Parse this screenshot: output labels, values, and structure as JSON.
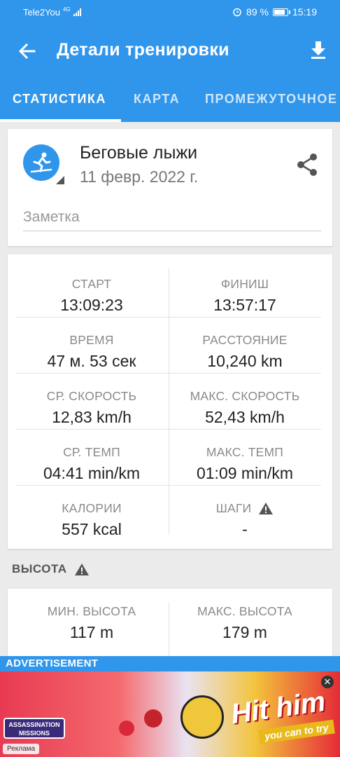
{
  "status_bar": {
    "carrier": "Tele2You",
    "network": "4G",
    "battery": "89 %",
    "battery_level": 0.89,
    "time": "15:19"
  },
  "toolbar": {
    "title": "Детали тренировки"
  },
  "tabs": [
    {
      "label": "СТАТИСТИКА",
      "active": true
    },
    {
      "label": "КАРТА",
      "active": false
    },
    {
      "label": "ПРОМЕЖУТОЧНОЕ",
      "active": false
    }
  ],
  "activity": {
    "name": "Беговые лыжи",
    "date": "11 февр. 2022 г.",
    "note_placeholder": "Заметка"
  },
  "stats": [
    {
      "left": {
        "label": "СТАРТ",
        "value": "13:09:23"
      },
      "right": {
        "label": "ФИНИШ",
        "value": "13:57:17"
      }
    },
    {
      "left": {
        "label": "ВРЕМЯ",
        "value": "47 м. 53 сек"
      },
      "right": {
        "label": "РАССТОЯНИЕ",
        "value": "10,240 km"
      }
    },
    {
      "left": {
        "label": "СР. СКОРОСТЬ",
        "value": "12,83 km/h"
      },
      "right": {
        "label": "МАКС. СКОРОСТЬ",
        "value": "52,43 km/h"
      }
    },
    {
      "left": {
        "label": "СР. ТЕМП",
        "value": "04:41 min/km"
      },
      "right": {
        "label": "МАКС. ТЕМП",
        "value": "01:09 min/km"
      }
    },
    {
      "left": {
        "label": "КАЛОРИИ",
        "value": "557 kcal"
      },
      "right": {
        "label": "ШАГИ",
        "value": "-",
        "warning": true
      }
    }
  ],
  "altitude": {
    "section_title": "ВЫСОТА",
    "min": {
      "label": "МИН. ВЫСОТА",
      "value": "117 m"
    },
    "max": {
      "label": "МАКС. ВЫСОТА",
      "value": "179 m"
    }
  },
  "ad": {
    "label": "ADVERTISEMENT",
    "tag": "Реклама",
    "headline": "Hit him",
    "cta": "you can to try",
    "game_logo": "ASSASSINATION MISSIONS",
    "close": "✕"
  },
  "colors": {
    "primary": "#2f96ec",
    "background": "#ebebeb"
  }
}
